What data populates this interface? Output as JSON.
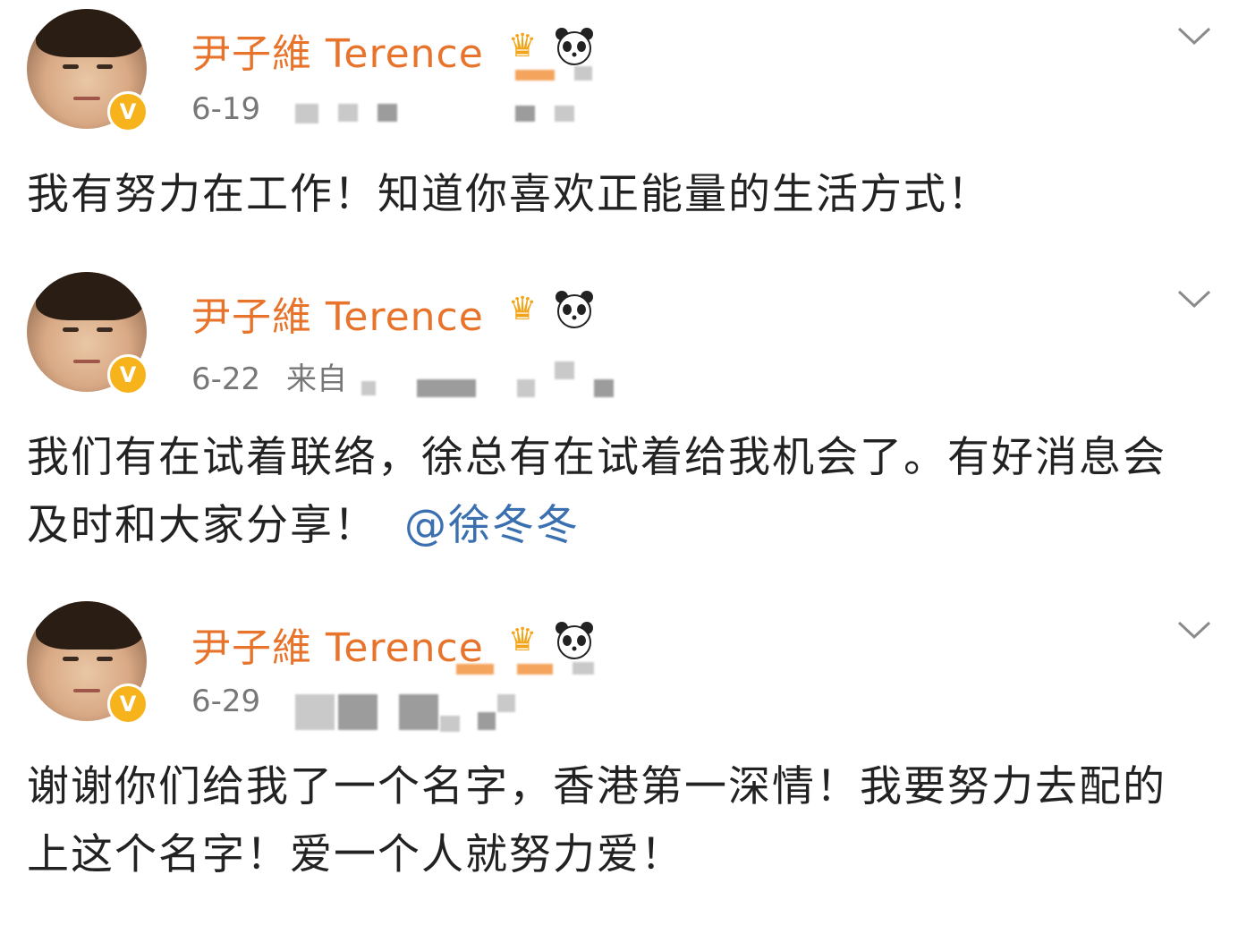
{
  "posts": [
    {
      "author": "尹子維 Terence",
      "date": "6-19",
      "source": "",
      "text": "我有努力在工作！知道你喜欢正能量的生活方式！",
      "mention": ""
    },
    {
      "author": "尹子維 Terence",
      "date": "6-22",
      "source": "来自",
      "text": "我们有在试着联络，徐总有在试着给我机会了。有好消息会及时和大家分享！",
      "mention": "@徐冬冬"
    },
    {
      "author": "尹子維 Terence",
      "date": "6-29",
      "source": "",
      "text": "谢谢你们给我了一个名字，香港第一深情！我要努力去配的上这个名字！爱一个人就努力爱！",
      "mention": ""
    }
  ],
  "icons": {
    "verified": "V",
    "crown": "crown-icon",
    "panda": "panda-icon",
    "chevron": "chevron-down-icon"
  },
  "colors": {
    "author": "#e8742c",
    "mention": "#3a6fb0",
    "verified": "#f6b31b",
    "meta": "#777777",
    "text": "#222222"
  }
}
